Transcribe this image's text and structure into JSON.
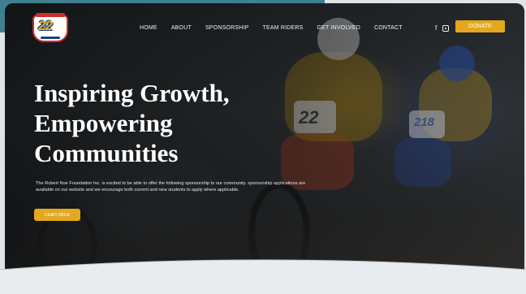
{
  "logo": {
    "number": "22",
    "icon": "rnf-logo-icon"
  },
  "nav": {
    "items": [
      "HOME",
      "ABOUT",
      "SPONSORSHIP",
      "TEAM RIDERS",
      "GET INVOLVED",
      "CONTACT"
    ]
  },
  "social": {
    "facebook": "f",
    "instagram_icon": "instagram-icon"
  },
  "donate_label": "DONATE",
  "hero": {
    "headline": [
      "Inspiring Growth,",
      "Empowering",
      "Communities"
    ],
    "intro": "The Robert Noe Foundation Inc. is excited to be able to offer the following sponsorship to our community. sponsorship applications are available on our website and we encourage both current and new students to apply where applicable.",
    "button_label": "Learn More",
    "plate_numbers": [
      "22",
      "218"
    ]
  },
  "colors": {
    "accent": "#e3a81d",
    "frame_teal": "#3f7f8f",
    "logo_red": "#c8302a",
    "logo_blue": "#1a3d8a"
  }
}
